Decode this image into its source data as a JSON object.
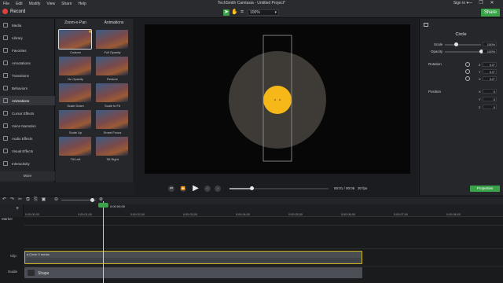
{
  "menu": [
    "File",
    "Edit",
    "Modify",
    "View",
    "Share",
    "Help"
  ],
  "app_title": "TechSmith Camtasia - Untitled Project*",
  "sign_in": "Sign in ▾",
  "window_buttons": [
    "—",
    "❐",
    "✕"
  ],
  "record_label": "Record",
  "zoom_value": "100%",
  "share_label": "Share",
  "rail_items": [
    {
      "label": "Media"
    },
    {
      "label": "Library"
    },
    {
      "label": "Favorites"
    },
    {
      "label": "Annotations"
    },
    {
      "label": "Transitions"
    },
    {
      "label": "Behaviors"
    },
    {
      "label": "Animations"
    },
    {
      "label": "Cursor Effects"
    },
    {
      "label": "Voice Narration"
    },
    {
      "label": "Audio Effects"
    },
    {
      "label": "Visual Effects"
    },
    {
      "label": "Interactivity"
    }
  ],
  "rail_more": "More",
  "panel": {
    "col1": "Zoom-n-Pan",
    "col2": "Animations",
    "thumbs": [
      "Custom",
      "Full Opacity",
      "No Opacity",
      "Restore",
      "Scale Down",
      "Scale to Fit",
      "Scale Up",
      "Smart Focus",
      "Tilt Left",
      "Tilt Right"
    ]
  },
  "playback": {
    "rewind": "⏮",
    "step_back": "⏪",
    "play": "▶",
    "prev": "‹",
    "next": "›",
    "timecode": "00:01 / 00:05",
    "fps": "30 fps",
    "progress": 0.22
  },
  "properties": {
    "title": "Circle",
    "scale_label": "Scale",
    "scale_value": "100%",
    "scale_level": 0.3,
    "opacity_label": "Opacity",
    "opacity_value": "100%",
    "opacity_level": 1.0,
    "rotation_label": "Rotation",
    "rotation": [
      {
        "axis": "Z",
        "value": "0.0°"
      },
      {
        "axis": "Y",
        "value": "0.0°"
      },
      {
        "axis": "X",
        "value": "0.0°"
      }
    ],
    "position_label": "Position",
    "position": [
      {
        "axis": "X",
        "value": "0"
      },
      {
        "axis": "Y",
        "value": "0"
      },
      {
        "axis": "Z",
        "value": "0"
      }
    ],
    "button": "Properties"
  },
  "timeline": {
    "toolbar_icons": [
      "↶",
      "↷",
      "✂",
      "⧉",
      "⎘",
      "▣",
      "⊖",
      "⊕"
    ],
    "add_track": "+",
    "playhead_time": "0:00:00;05",
    "ruler_ticks": [
      "0:00:00;00",
      "0:00:01;00",
      "0:00:02;00",
      "0:00:03;00",
      "0:00:04;00",
      "0:00:05;00",
      "0:00:06;00",
      "0:00:07;00",
      "0:00:08;00"
    ],
    "track_names": [
      "Marker",
      "Clip",
      "Guide"
    ],
    "clip_label": "◂ Circle  0 media",
    "shape_label": "Shape"
  },
  "colors": {
    "accent": "#3aa34a",
    "circle_outer": "#3e3b36",
    "circle_inner": "#f5b818",
    "clip_border": "#c9b21c"
  }
}
